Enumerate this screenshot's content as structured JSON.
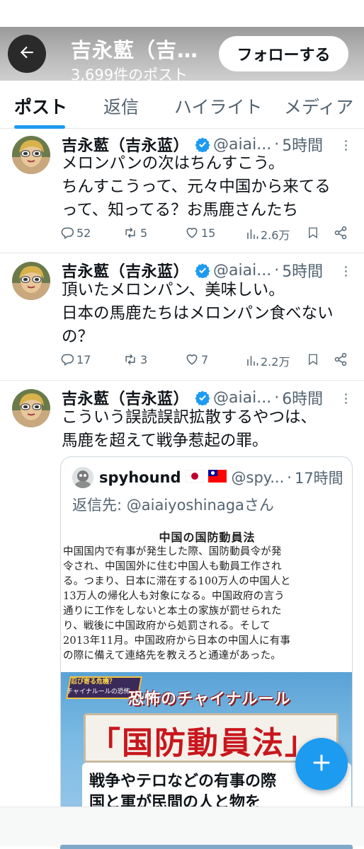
{
  "header": {
    "display_name": "吉永藍（吉…",
    "post_count": "3,699件のポスト",
    "follow_label": "フォローする",
    "back_icon": "arrow-left-icon"
  },
  "tabs": [
    {
      "label": "ポスト",
      "active": true
    },
    {
      "label": "返信",
      "active": false
    },
    {
      "label": "ハイライト",
      "active": false
    },
    {
      "label": "メディア",
      "active": false
    }
  ],
  "posts": [
    {
      "display_name": "吉永藍（吉永蓝）",
      "handle": "@aiai...",
      "separator": "·",
      "time": "5時間",
      "lines": [
        "メロンパンの次はちんすこう。",
        "ちんすこうって、元々中国から来てる",
        "って、知ってる？お馬鹿さんたち"
      ],
      "replies": "52",
      "reposts": "5",
      "likes": "15",
      "views": "2.6万"
    },
    {
      "display_name": "吉永藍（吉永蓝）",
      "handle": "@aiai...",
      "separator": "·",
      "time": "5時間",
      "lines": [
        "頂いたメロンパン、美味しい。",
        "日本の馬鹿たちはメロンパン食べない",
        "の？"
      ],
      "replies": "17",
      "reposts": "3",
      "likes": "7",
      "views": "2.2万"
    },
    {
      "display_name": "吉永藍（吉永蓝）",
      "handle": "@aiai...",
      "separator": "·",
      "time": "6時間",
      "lines": [
        "こういう誤読誤訳拡散するやつは、",
        "馬鹿を超えて戦争惹起の罪。"
      ]
    }
  ],
  "quote": {
    "name": "spyhound",
    "handle": "@spy...",
    "separator": "·",
    "time": "17時間",
    "reply_to": "返信先: @aiaiyoshinagaさん",
    "doc": {
      "title": "中国の国防動員法",
      "lines": [
        "中国国内で有事が発生した際、国防動員令が発",
        "令され、中国国外に住む中国人も動員工作され",
        "る。つまり、日本に滞在する100万人の中国人と",
        "13万人の帰化人も対象になる。中国政府の言う",
        "通りに工作をしないと本土の家族が罰せられた",
        "り、戦後に中国政府から処罰される。そして",
        "2013年11月。中国政府から日本の中国人に有事",
        "の際に備えて連絡先を教えろと通達があった。"
      ]
    },
    "tv": {
      "tag_top": "忍び寄る危機？",
      "tag_bottom": "チャイナルールの恐怖",
      "subtitle": "恐怖のチャイナルール",
      "main": "「国防動員法」",
      "line1": "戦争やテロなどの有事の際",
      "line2": "国と軍が民間の人と物を"
    }
  },
  "fab_icon": "plus-icon"
}
